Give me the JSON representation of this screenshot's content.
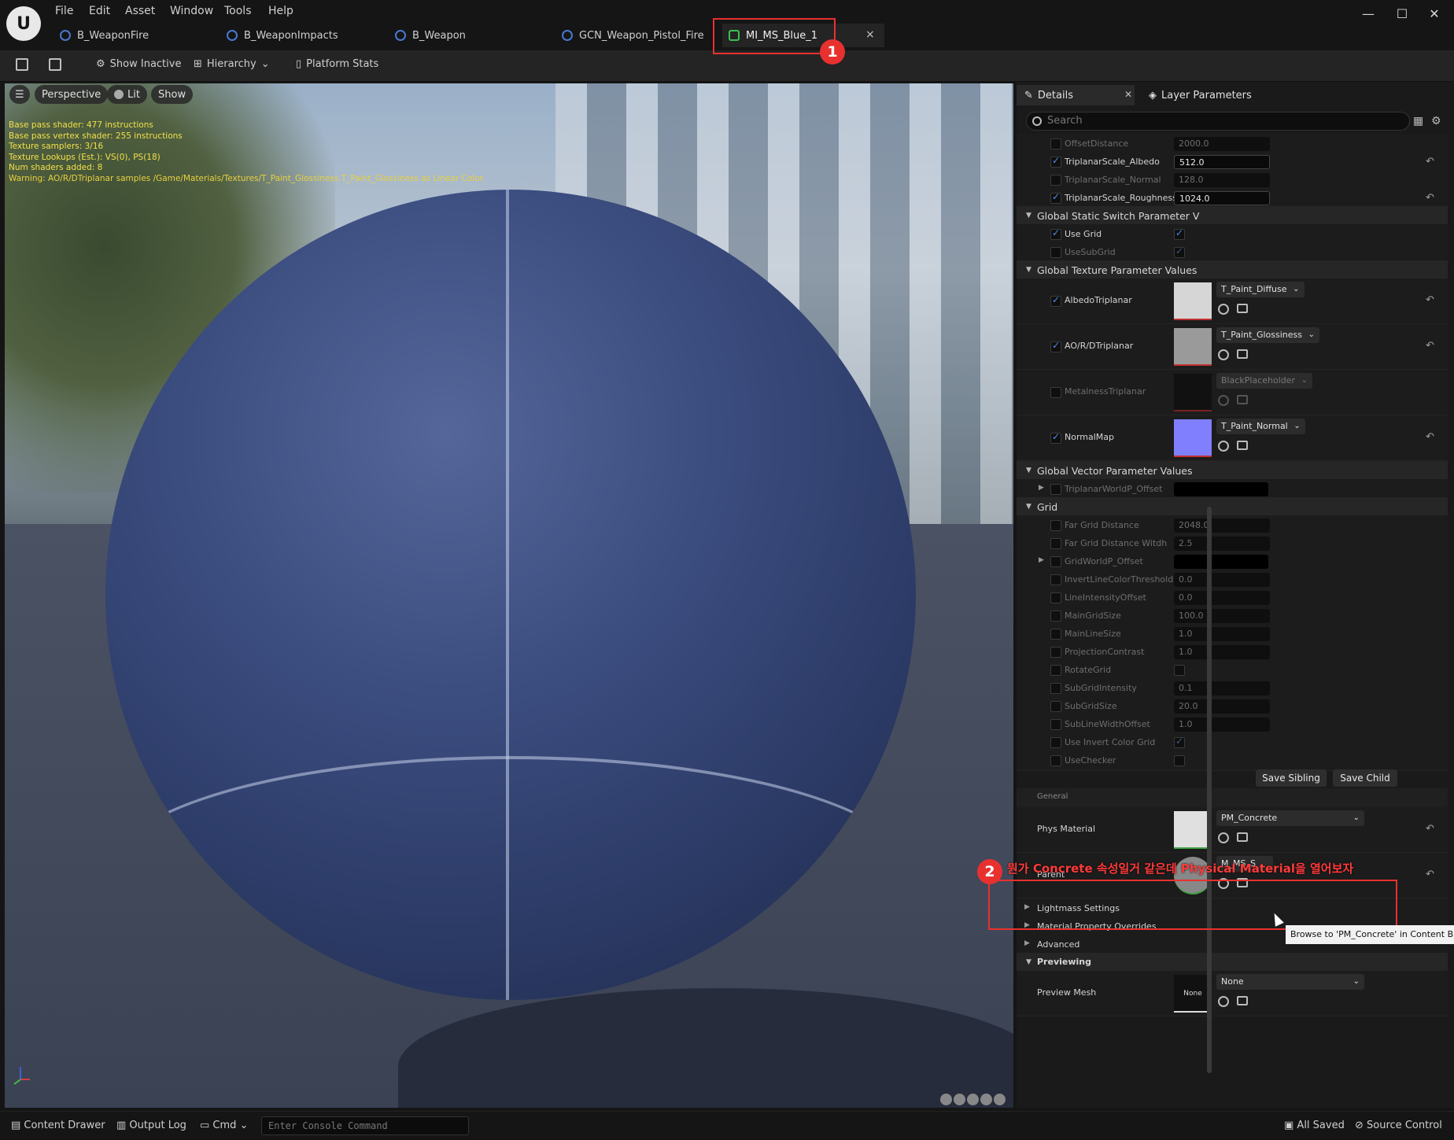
{
  "menu": [
    "File",
    "Edit",
    "Asset",
    "Window",
    "Tools",
    "Help"
  ],
  "window_controls": {
    "minimize": "—",
    "maximize": "☐",
    "close": "✕"
  },
  "tabs": [
    {
      "label": "B_WeaponFire",
      "active": false
    },
    {
      "label": "B_WeaponImpacts",
      "active": false
    },
    {
      "label": "B_Weapon",
      "active": false
    },
    {
      "label": "GCN_Weapon_Pistol_Fire",
      "active": false
    },
    {
      "label": "MI_MS_Blue_1",
      "active": true
    }
  ],
  "tab_close": "×",
  "toolbar": {
    "show_inactive": "Show Inactive",
    "hierarchy": "Hierarchy",
    "platform_stats": "Platform Stats"
  },
  "viewport": {
    "perspective": "Perspective",
    "lit": "Lit",
    "show": "Show",
    "stats": [
      "Base pass shader: 477 instructions",
      "Base pass vertex shader: 255 instructions",
      "Texture samplers: 3/16",
      "Texture Lookups (Est.): VS(0), PS(18)",
      "Num shaders added: 8",
      "Warning: AO/R/DTriplanar samples /Game/Materials/Textures/T_Paint_Glossiness.T_Paint_Glossiness as Linear Color."
    ]
  },
  "details": {
    "tab_label": "Details",
    "layer_tab_label": "Layer Parameters",
    "search_placeholder": "Search",
    "rows": [
      {
        "name": "OffsetDistance",
        "value": "2000.0",
        "checked": false
      },
      {
        "name": "TriplanarScale_Albedo",
        "value": "512.0",
        "checked": true
      },
      {
        "name": "TriplanarScale_Normal",
        "value": "128.0",
        "checked": false
      },
      {
        "name": "TriplanarScale_Roughness",
        "value": "1024.0",
        "checked": true
      }
    ],
    "static_switch_section": "Global Static Switch Parameter V",
    "switches": [
      {
        "name": "Use Grid",
        "checked": true,
        "value_checked": true
      },
      {
        "name": "UseSubGrid",
        "checked": false,
        "value_checked": true
      }
    ],
    "texture_section": "Global Texture Parameter Values",
    "textures": [
      {
        "name": "AlbedoTriplanar",
        "asset": "T_Paint_Diffuse",
        "checked": true,
        "thumb": "#d6d6d6"
      },
      {
        "name": "AO/R/DTriplanar",
        "asset": "T_Paint_Glossiness",
        "checked": true,
        "thumb": "#9a9a9a"
      },
      {
        "name": "MetalnessTriplanar",
        "asset": "BlackPlaceholder",
        "checked": false,
        "thumb": "#111111"
      },
      {
        "name": "NormalMap",
        "asset": "T_Paint_Normal",
        "checked": true,
        "thumb": "#8080ff"
      }
    ],
    "vector_section": "Global Vector Parameter Values",
    "vector_row": "TriplanarWorldP_Offset",
    "grid_section": "Grid",
    "grid_rows": [
      {
        "name": "Far Grid Distance",
        "value": "2048.0"
      },
      {
        "name": "Far Grid Distance Witdh",
        "value": "2.5"
      },
      {
        "name": "GridWorldP_Offset",
        "value": ""
      },
      {
        "name": "InvertLineColorThreshold",
        "value": "0.0"
      },
      {
        "name": "LineIntensityOffset",
        "value": "0.0"
      },
      {
        "name": "MainGridSize",
        "value": "100.0"
      },
      {
        "name": "MainLineSize",
        "value": "1.0"
      },
      {
        "name": "ProjectionContrast",
        "value": "1.0"
      },
      {
        "name": "RotateGrid",
        "value": ""
      },
      {
        "name": "SubGridIntensity",
        "value": "0.1"
      },
      {
        "name": "SubGridSize",
        "value": "20.0"
      },
      {
        "name": "SubLineWidthOffset",
        "value": "1.0"
      },
      {
        "name": "Use Invert Color Grid",
        "value": ""
      },
      {
        "name": "UseChecker",
        "value": ""
      }
    ],
    "save_sibling": "Save Sibling",
    "save_child": "Save Child",
    "general_label": "General",
    "phys_material": {
      "label": "Phys Material",
      "asset": "PM_Concrete"
    },
    "parent": {
      "label": "Parent",
      "asset": "M_MS_S"
    },
    "collapsed_sections": [
      "Lightmass Settings",
      "Material Property Overrides",
      "Advanced"
    ],
    "previewing_section": "Previewing",
    "preview_mesh": {
      "label": "Preview Mesh",
      "asset": "None",
      "thumb_label": "None"
    }
  },
  "annotations": {
    "badge1": "1",
    "badge2": "2",
    "note": "뭔가 Concrete 속성일거 같은데 Physical Material을 열어보자",
    "tooltip": "Browse to 'PM_Concrete' in Content Br"
  },
  "statusbar": {
    "content_drawer": "Content Drawer",
    "output_log": "Output Log",
    "cmd": "Cmd",
    "console_placeholder": "Enter Console Command",
    "all_saved": "All Saved",
    "source_control": "Source Control"
  }
}
